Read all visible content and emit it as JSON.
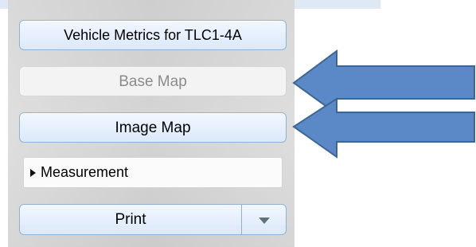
{
  "toolbar": {
    "vehicle_metrics_label": "Vehicle Metrics for TLC1-4A",
    "base_map_label": "Base Map",
    "image_map_label": "Image Map",
    "measurement_label": "Measurement",
    "print_label": "Print"
  },
  "icons": {
    "measurement_expand": "disclosure-triangle-icon",
    "print_menu": "chevron-down-icon",
    "callout": "left-arrow-icon"
  },
  "colors": {
    "accent_blue": "#5b89c8",
    "button_border": "#8fb2d8",
    "panel_background": "#d9d9d9",
    "disabled_text": "#8b8b8b"
  }
}
